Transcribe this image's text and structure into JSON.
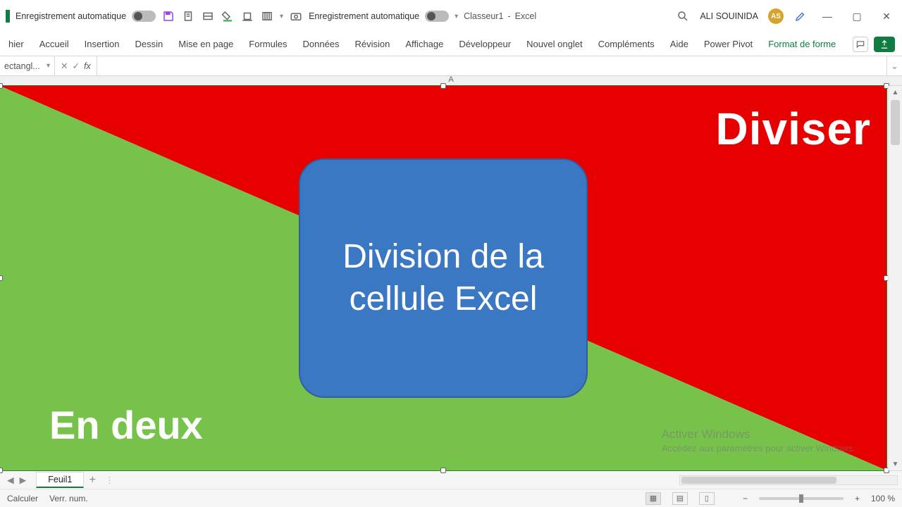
{
  "qat": {
    "autosave_label": "Enregistrement automatique",
    "autosave2_label": "Enregistrement automatique",
    "doc_title": "Classeur1",
    "app_name": "Excel"
  },
  "user": {
    "name": "ALI SOUINIDA",
    "initials": "AS"
  },
  "ribbon": {
    "tabs": [
      "hier",
      "Accueil",
      "Insertion",
      "Dessin",
      "Mise en page",
      "Formules",
      "Données",
      "Révision",
      "Affichage",
      "Développeur",
      "Nouvel onglet",
      "Compléments",
      "Aide",
      "Power Pivot"
    ],
    "context_tab": "Format de forme"
  },
  "namebox": {
    "value": "ectangl..."
  },
  "columns": {
    "A": "A"
  },
  "shapes": {
    "red_text": "Diviser",
    "green_text": "En deux",
    "center_box": "Division de la cellule Excel"
  },
  "watermark": {
    "line1": "Activer Windows",
    "line2": "Accédez aux paramètres pour activer Windows."
  },
  "sheet": {
    "name": "Feuil1",
    "add_tip": "+"
  },
  "status": {
    "calc": "Calculer",
    "numlock": "Verr. num.",
    "zoom": "100 %"
  }
}
